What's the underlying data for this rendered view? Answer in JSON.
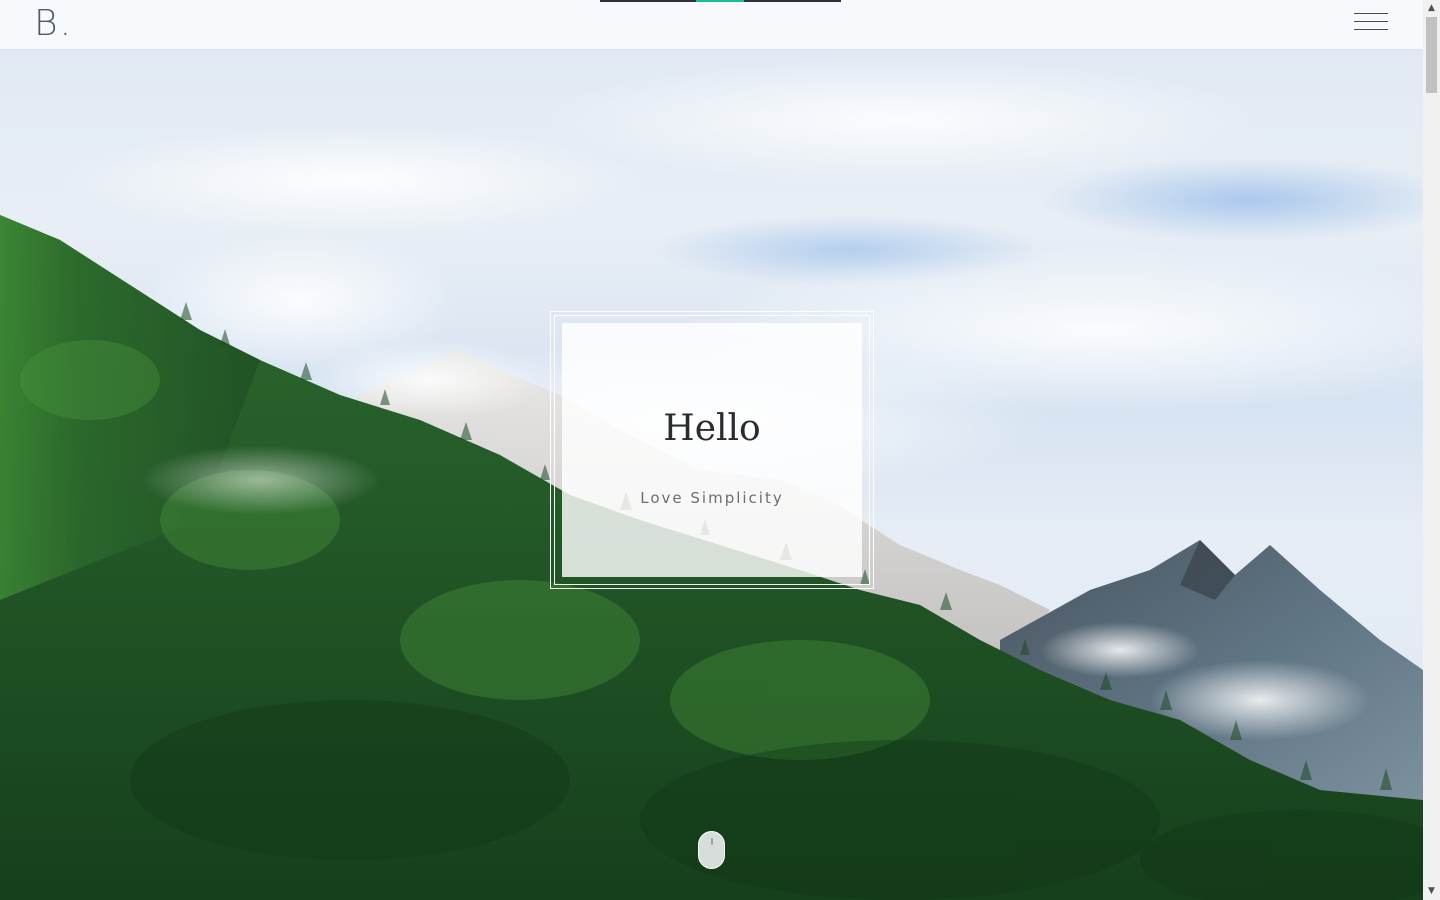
{
  "topbar": {
    "logo_letter": "B",
    "logo_dot": ".",
    "menu_icon": "hamburger-menu-icon"
  },
  "progress": {
    "accent_color": "#1abc9c",
    "track_color": "#2f3338"
  },
  "hero": {
    "title": "Hello",
    "subtitle": "Love Simplicity",
    "scroll_icon": "mouse-scroll-icon"
  },
  "scrollbar": {
    "up_arrow": "▲",
    "down_arrow": "▼"
  }
}
